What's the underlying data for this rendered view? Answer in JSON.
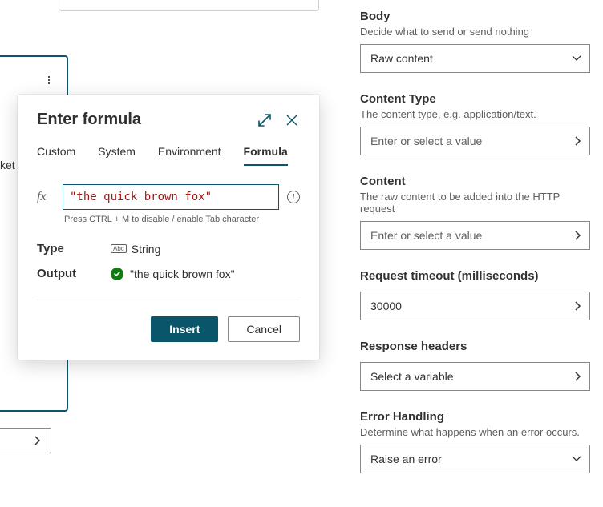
{
  "modal": {
    "title": "Enter formula",
    "tabs": [
      "Custom",
      "System",
      "Environment",
      "Formula"
    ],
    "active_tab": "Formula",
    "fx_label": "fx",
    "formula_value": "\"the quick brown fox\"",
    "hint": "Press CTRL + M to disable / enable Tab character",
    "type_label": "Type",
    "type_value": "String",
    "output_label": "Output",
    "output_value": "\"the quick brown fox\"",
    "insert": "Insert",
    "cancel": "Cancel"
  },
  "panel": {
    "body": {
      "label": "Body",
      "desc": "Decide what to send or send nothing",
      "value": "Raw content"
    },
    "content_type": {
      "label": "Content Type",
      "desc": "The content type, e.g. application/text.",
      "placeholder": "Enter or select a value"
    },
    "content": {
      "label": "Content",
      "desc": "The raw content to be added into the HTTP request",
      "placeholder": "Enter or select a value"
    },
    "timeout": {
      "label": "Request timeout (milliseconds)",
      "value": "30000"
    },
    "response_headers": {
      "label": "Response headers",
      "placeholder": "Select a variable"
    },
    "error_handling": {
      "label": "Error Handling",
      "desc": "Determine what happens when an error occurs.",
      "value": "Raise an error"
    }
  },
  "bg": {
    "ket": "ket"
  }
}
